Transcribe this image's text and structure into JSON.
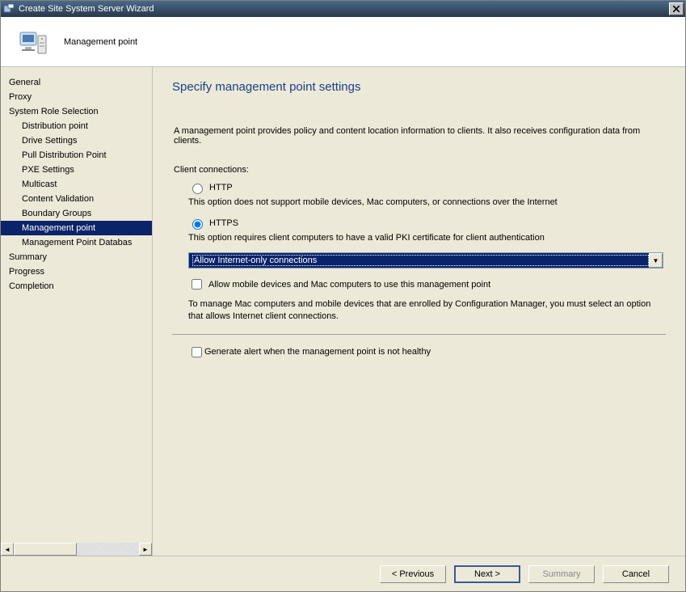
{
  "window": {
    "title": "Create Site System Server Wizard"
  },
  "header": {
    "subtitle": "Management point"
  },
  "sidebar": {
    "items": [
      {
        "label": "General",
        "indent": false,
        "selected": false
      },
      {
        "label": "Proxy",
        "indent": false,
        "selected": false
      },
      {
        "label": "System Role Selection",
        "indent": false,
        "selected": false
      },
      {
        "label": "Distribution point",
        "indent": true,
        "selected": false
      },
      {
        "label": "Drive Settings",
        "indent": true,
        "selected": false
      },
      {
        "label": "Pull Distribution Point",
        "indent": true,
        "selected": false
      },
      {
        "label": "PXE Settings",
        "indent": true,
        "selected": false
      },
      {
        "label": "Multicast",
        "indent": true,
        "selected": false
      },
      {
        "label": "Content Validation",
        "indent": true,
        "selected": false
      },
      {
        "label": "Boundary Groups",
        "indent": true,
        "selected": false
      },
      {
        "label": "Management point",
        "indent": true,
        "selected": true
      },
      {
        "label": "Management Point Databas",
        "indent": true,
        "selected": false
      },
      {
        "label": "Summary",
        "indent": false,
        "selected": false
      },
      {
        "label": "Progress",
        "indent": false,
        "selected": false
      },
      {
        "label": "Completion",
        "indent": false,
        "selected": false
      }
    ]
  },
  "main": {
    "heading": "Specify management point settings",
    "description": "A management point provides policy and content location information to clients.  It also receives configuration data from clients.",
    "client_connections_label": "Client connections:",
    "http_label": "HTTP",
    "http_note": "This option does not support mobile devices, Mac computers, or connections over the Internet",
    "https_label": "HTTPS",
    "https_note": "This option requires client computers to have a valid PKI certificate for client authentication",
    "connection_mode_selected": "https",
    "dropdown_selected": "Allow Internet-only connections",
    "allow_mobile_label": "Allow mobile devices and Mac computers to use this management point",
    "allow_mobile_checked": false,
    "mac_note": "To manage Mac computers and mobile devices that are enrolled by Configuration Manager, you must select an option that allows Internet client connections.",
    "alert_label": "Generate alert when the management point is not healthy",
    "alert_checked": false
  },
  "buttons": {
    "previous": "< Previous",
    "next": "Next >",
    "summary": "Summary",
    "cancel": "Cancel"
  }
}
